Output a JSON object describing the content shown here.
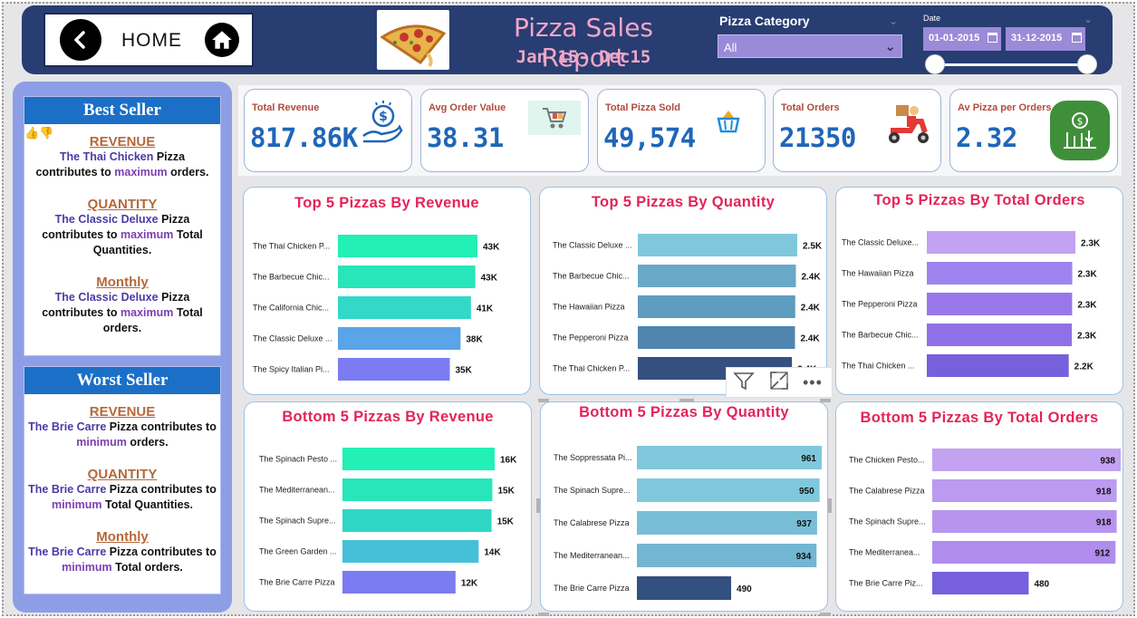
{
  "header": {
    "home_label": "HOME",
    "title": "Pizza Sales Report",
    "subtitle": "Jan 15- Dec15",
    "category_label": "Pizza Category",
    "category_value": "All",
    "date_label": "Date",
    "date_start": "01-01-2015",
    "date_end": "31-12-2015"
  },
  "best_seller": {
    "heading": "Best Seller",
    "sections": [
      {
        "title": "REVENUE",
        "name": "The Thai Chicken",
        "mid": " Pizza contributes to ",
        "kw": "maximum",
        "tail": " orders."
      },
      {
        "title": "QUANTITY",
        "name": "The Classic Deluxe",
        "mid": " Pizza contributes to ",
        "kw": "maximum",
        "tail": " Total Quantities."
      },
      {
        "title": "Monthly",
        "name": "The Classic Deluxe",
        "mid": " Pizza contributes to ",
        "kw": "maximum",
        "tail": " Total orders."
      }
    ]
  },
  "worst_seller": {
    "heading": "Worst Seller",
    "sections": [
      {
        "title": "REVENUE",
        "name": "The Brie Carre",
        "mid": " Pizza contributes to ",
        "kw": "minimum",
        "tail": " orders."
      },
      {
        "title": "QUANTITY",
        "name": "The Brie Carre",
        "mid": " Pizza contributes to ",
        "kw": "minimum",
        "tail": " Total Quantities."
      },
      {
        "title": "Monthly",
        "name": "The Brie Carre",
        "mid": " Pizza contributes to ",
        "kw": "minimum",
        "tail": " Total orders."
      }
    ]
  },
  "kpis": [
    {
      "title": "Total Revenue",
      "value": "817.86K",
      "icon": "money-hand-icon"
    },
    {
      "title": "Avg Order Value",
      "value": "38.31",
      "icon": "shopping-cart-icon"
    },
    {
      "title": "Total Pizza Sold",
      "value": "49,574",
      "icon": "pizza-basket-icon"
    },
    {
      "title": "Total Orders",
      "value": "21350",
      "icon": "delivery-scooter-icon"
    },
    {
      "title": "Av Pizza per Orders",
      "value": "2.32",
      "icon": "finance-chart-icon"
    }
  ],
  "colors": {
    "header_bg": "#283d72",
    "title_pink": "#f0a7c6",
    "chart_title": "#e3245a",
    "kpi_value": "#1f66b8",
    "left_panel": "#8e9ee6"
  },
  "chart_data": [
    {
      "type": "bar",
      "orientation": "horizontal",
      "title": "Top 5 Pizzas By Revenue",
      "categories": [
        "The Thai Chicken P...",
        "The Barbecue Chic...",
        "The California Chic...",
        "The Classic Deluxe ...",
        "The Spicy Italian Pi..."
      ],
      "values": [
        43434,
        42768,
        41410,
        38180,
        34831
      ],
      "labels": [
        "43K",
        "43K",
        "41K",
        "38K",
        "35K"
      ],
      "colors": [
        "#22f0b4",
        "#28e6ba",
        "#32d8c8",
        "#5aa4e8",
        "#7b7cf2"
      ]
    },
    {
      "type": "bar",
      "orientation": "horizontal",
      "title": "Top 5 Pizzas By Quantity",
      "categories": [
        "The Classic Deluxe ...",
        "The Barbecue Chic...",
        "The Hawaiian Pizza",
        "The Pepperoni Pizza",
        "The Thai Chicken P..."
      ],
      "values": [
        2453,
        2432,
        2422,
        2418,
        2371
      ],
      "labels": [
        "2.5K",
        "2.4K",
        "2.4K",
        "2.4K",
        "2.4K"
      ],
      "colors": [
        "#7fc8dc",
        "#6aa8c8",
        "#5e9cc0",
        "#4e86b0",
        "#34507e"
      ]
    },
    {
      "type": "bar",
      "orientation": "horizontal",
      "title": "Top 5 Pizzas By Total Orders",
      "categories": [
        "The Classic Deluxe...",
        "The Hawaiian Pizza",
        "The Pepperoni Pizza",
        "The Barbecue Chic...",
        "The Thai Chicken ..."
      ],
      "values": [
        2329,
        2280,
        2278,
        2273,
        2225
      ],
      "labels": [
        "2.3K",
        "2.3K",
        "2.3K",
        "2.3K",
        "2.2K"
      ],
      "colors": [
        "#c3a2f2",
        "#9e84ee",
        "#9878ea",
        "#9070e6",
        "#7660dc"
      ]
    },
    {
      "type": "bar",
      "orientation": "horizontal",
      "title": "Bottom 5 Pizzas By Revenue",
      "categories": [
        "The Spinach Pesto ...",
        "The Mediterranean...",
        "The Spinach Supre...",
        "The Green Garden ...",
        "The Brie Carre Pizza"
      ],
      "values": [
        15596,
        15360,
        15277,
        13956,
        11588
      ],
      "labels": [
        "16K",
        "15K",
        "15K",
        "14K",
        "12K"
      ],
      "colors": [
        "#22f0b4",
        "#28e6ba",
        "#2ed8c4",
        "#46c0d8",
        "#7b7cf2"
      ]
    },
    {
      "type": "bar",
      "orientation": "horizontal",
      "title": "Bottom 5 Pizzas By Quantity",
      "categories": [
        "The Soppressata Pi...",
        "The Spinach Supre...",
        "The Calabrese Pizza",
        "The Mediterranean...",
        "The Brie Carre Pizza"
      ],
      "values": [
        961,
        950,
        937,
        934,
        490
      ],
      "labels": [
        "961",
        "950",
        "937",
        "934",
        "490"
      ],
      "colors": [
        "#7fc8dc",
        "#7fc8dc",
        "#78bed6",
        "#72b6d2",
        "#34507e"
      ]
    },
    {
      "type": "bar",
      "orientation": "horizontal",
      "title": "Bottom 5 Pizzas By Total Orders",
      "categories": [
        "The Chicken Pesto...",
        "The Calabrese Pizza",
        "The Spinach Supre...",
        "The Mediterranea...",
        "The Brie Carre Piz..."
      ],
      "values": [
        938,
        918,
        918,
        912,
        480
      ],
      "labels": [
        "938",
        "918",
        "918",
        "912",
        "480"
      ],
      "colors": [
        "#c3a2f2",
        "#bb9af0",
        "#b894ee",
        "#b08cec",
        "#7660dc"
      ]
    }
  ]
}
